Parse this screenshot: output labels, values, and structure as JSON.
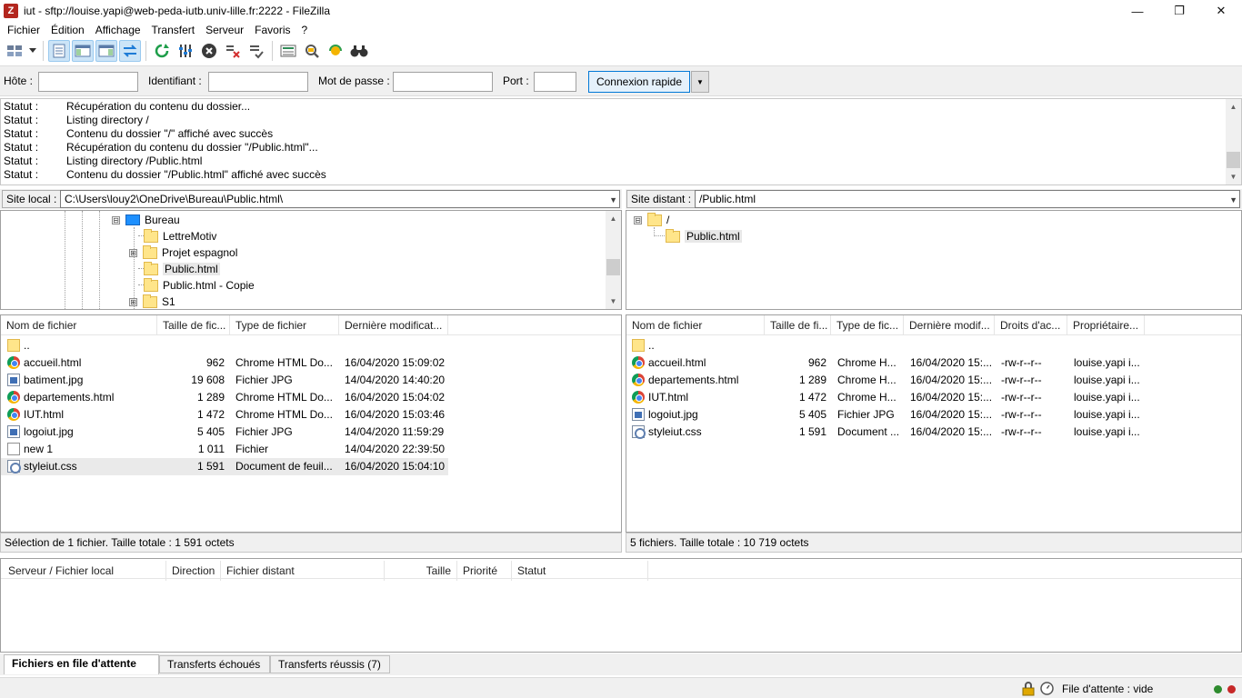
{
  "window": {
    "title": "iut - sftp://louise.yapi@web-peda-iutb.univ-lille.fr:2222 - FileZilla",
    "app_icon_letter": "Z",
    "minimize": "—",
    "maximize": "❐",
    "close": "✕"
  },
  "menu": [
    "Fichier",
    "Édition",
    "Affichage",
    "Transfert",
    "Serveur",
    "Favoris",
    "?"
  ],
  "toolbar": {
    "icons": [
      "site-manager-icon",
      "dropdown-arrow-icon",
      "toggle-message-log-icon",
      "toggle-local-tree-icon",
      "toggle-remote-tree-icon",
      "toggle-queue-icon",
      "refresh-icon",
      "process-queue-icon",
      "cancel-icon",
      "disconnect-icon",
      "reconnect-icon",
      "directory-listing-filters-icon",
      "toggle-comparison-icon",
      "synchronized-browsing-icon",
      "search-files-icon"
    ]
  },
  "quickconnect": {
    "host_label": "Hôte :",
    "user_label": "Identifiant :",
    "pass_label": "Mot de passe :",
    "port_label": "Port :",
    "host_value": "",
    "user_value": "",
    "pass_value": "",
    "port_value": "",
    "connect_label": "Connexion rapide",
    "dropdown_glyph": "▼"
  },
  "log": [
    {
      "key": "Statut :",
      "msg": "Récupération du contenu du dossier..."
    },
    {
      "key": "Statut :",
      "msg": "Listing directory /"
    },
    {
      "key": "Statut :",
      "msg": "Contenu du dossier \"/\" affiché avec succès"
    },
    {
      "key": "Statut :",
      "msg": "Récupération du contenu du dossier \"/Public.html\"..."
    },
    {
      "key": "Statut :",
      "msg": "Listing directory /Public.html"
    },
    {
      "key": "Statut :",
      "msg": "Contenu du dossier \"/Public.html\" affiché avec succès"
    }
  ],
  "local": {
    "site_label": "Site local :",
    "path": "C:\\Users\\louy2\\OneDrive\\Bureau\\Public.html\\",
    "tree": [
      {
        "label": "Bureau",
        "expander": "⊟"
      },
      {
        "label": "LettreMotiv",
        "expander": ""
      },
      {
        "label": "Projet espagnol",
        "expander": "⊞"
      },
      {
        "label": "Public.html",
        "expander": ""
      },
      {
        "label": "Public.html - Copie",
        "expander": ""
      },
      {
        "label": "S1",
        "expander": "⊞"
      }
    ],
    "columns": [
      "Nom de fichier",
      "Taille de fic...",
      "Type de fichier",
      "Dernière modificat..."
    ],
    "files": [
      {
        "name": "..",
        "size": "",
        "type": "",
        "date": "",
        "icon": "folder"
      },
      {
        "name": "accueil.html",
        "size": "962",
        "type": "Chrome HTML Do...",
        "date": "16/04/2020 15:09:02",
        "icon": "chrome"
      },
      {
        "name": "batiment.jpg",
        "size": "19 608",
        "type": "Fichier JPG",
        "date": "14/04/2020 14:40:20",
        "icon": "image"
      },
      {
        "name": "departements.html",
        "size": "1 289",
        "type": "Chrome HTML Do...",
        "date": "16/04/2020 15:04:02",
        "icon": "chrome"
      },
      {
        "name": "IUT.html",
        "size": "1 472",
        "type": "Chrome HTML Do...",
        "date": "16/04/2020 15:03:46",
        "icon": "chrome"
      },
      {
        "name": "logoiut.jpg",
        "size": "5 405",
        "type": "Fichier JPG",
        "date": "14/04/2020 11:59:29",
        "icon": "image"
      },
      {
        "name": "new 1",
        "size": "1 011",
        "type": "Fichier",
        "date": "14/04/2020 22:39:50",
        "icon": "doc"
      },
      {
        "name": "styleiut.css",
        "size": "1 591",
        "type": "Document de feuil...",
        "date": "16/04/2020 15:04:10",
        "icon": "css"
      }
    ],
    "status": "Sélection de 1 fichier. Taille totale : 1 591 octets"
  },
  "remote": {
    "site_label": "Site distant :",
    "path": "/Public.html",
    "tree": [
      {
        "label": "/",
        "expander": "⊟"
      },
      {
        "label": "Public.html",
        "expander": ""
      }
    ],
    "columns": [
      "Nom de fichier",
      "Taille de fi...",
      "Type de fic...",
      "Dernière modif...",
      "Droits d'ac...",
      "Propriétaire..."
    ],
    "files": [
      {
        "name": "..",
        "size": "",
        "type": "",
        "date": "",
        "perms": "",
        "owner": "",
        "icon": "folder"
      },
      {
        "name": "accueil.html",
        "size": "962",
        "type": "Chrome H...",
        "date": "16/04/2020 15:...",
        "perms": "-rw-r--r--",
        "owner": "louise.yapi i...",
        "icon": "chrome"
      },
      {
        "name": "departements.html",
        "size": "1 289",
        "type": "Chrome H...",
        "date": "16/04/2020 15:...",
        "perms": "-rw-r--r--",
        "owner": "louise.yapi i...",
        "icon": "chrome"
      },
      {
        "name": "IUT.html",
        "size": "1 472",
        "type": "Chrome H...",
        "date": "16/04/2020 15:...",
        "perms": "-rw-r--r--",
        "owner": "louise.yapi i...",
        "icon": "chrome"
      },
      {
        "name": "logoiut.jpg",
        "size": "5 405",
        "type": "Fichier JPG",
        "date": "16/04/2020 15:...",
        "perms": "-rw-r--r--",
        "owner": "louise.yapi i...",
        "icon": "image"
      },
      {
        "name": "styleiut.css",
        "size": "1 591",
        "type": "Document ...",
        "date": "16/04/2020 15:...",
        "perms": "-rw-r--r--",
        "owner": "louise.yapi i...",
        "icon": "css"
      }
    ],
    "status": "5 fichiers. Taille totale : 10 719 octets"
  },
  "queue": {
    "columns": [
      "Serveur / Fichier local",
      "Direction",
      "Fichier distant",
      "Taille",
      "Priorité",
      "Statut"
    ],
    "tabs": [
      "Fichiers en file d'attente",
      "Transferts échoués",
      "Transferts réussis (7)"
    ]
  },
  "statusbar": {
    "queue_text": "File d'attente : vide"
  },
  "colors": {
    "accent": "#0078d7",
    "folder": "#ffe58a",
    "led_green": "#2e8b2e",
    "led_red": "#c62828"
  }
}
